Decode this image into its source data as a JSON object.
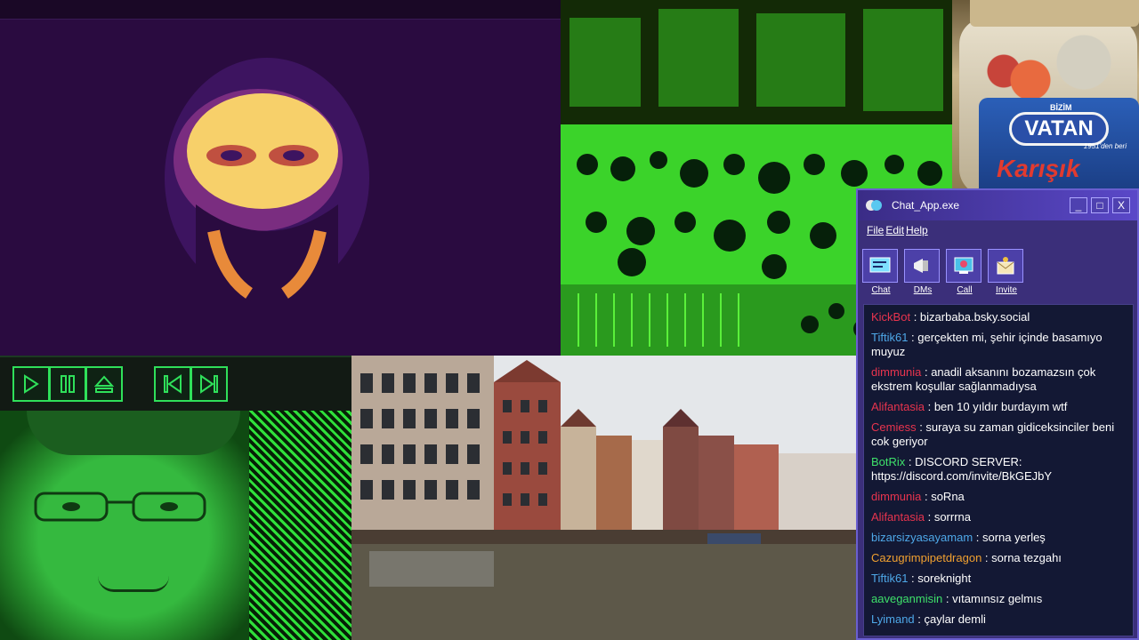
{
  "chat": {
    "title": "Chat_App.exe",
    "window_buttons": [
      "_",
      "□",
      "X"
    ],
    "menu": [
      "File",
      "Edit",
      "Help"
    ],
    "toolbar": [
      {
        "label": "Chat",
        "icon": "chat-icon"
      },
      {
        "label": "DMs",
        "icon": "megaphone-icon"
      },
      {
        "label": "Call",
        "icon": "call-icon"
      },
      {
        "label": "Invite",
        "icon": "invite-icon"
      }
    ],
    "messages": [
      {
        "user": "KickBot",
        "color": "#e8344e",
        "text": "bizarbaba.bsky.social"
      },
      {
        "user": "Tiftik61",
        "color": "#4ea8e8",
        "text": "gerçekten mi, şehir içinde basamıyo muyuz"
      },
      {
        "user": "dimmunia",
        "color": "#e8344e",
        "text": "anadil aksanını bozamazsın çok ekstrem koşullar sağlanmadıysa"
      },
      {
        "user": "Alifantasia",
        "color": "#e8344e",
        "text": "ben 10 yıldır burdayım wtf"
      },
      {
        "user": "Cemiess",
        "color": "#e8344e",
        "text": "suraya su zaman gidiceksinciler beni cok geriyor"
      },
      {
        "user": "BotRix",
        "color": "#3ee06a",
        "text": "DISCORD SERVER: https://discord.com/invite/BkGEJbY"
      },
      {
        "user": "dimmunia",
        "color": "#e8344e",
        "text": "soRna"
      },
      {
        "user": "Alifantasia",
        "color": "#e8344e",
        "text": "sorrrna"
      },
      {
        "user": "bizarsizyasayamam",
        "color": "#4ea8e8",
        "text": "sorna yerleş"
      },
      {
        "user": "Cazugrimpipetdragon",
        "color": "#f0a030",
        "text": "sorna tezgahı"
      },
      {
        "user": "Tiftik61",
        "color": "#4ea8e8",
        "text": "soreknight"
      },
      {
        "user": "aaveganmisin",
        "color": "#3ee06a",
        "text": "vıtamınsız gelmıs"
      },
      {
        "user": "Lyimand",
        "color": "#4ea8e8",
        "text": "çaylar demli"
      }
    ]
  },
  "jar": {
    "brand_top": "BİZİM",
    "brand": "VATAN",
    "brand_sub": "1951'den beri",
    "variety": "Karışık"
  },
  "controls": [
    {
      "name": "play-button",
      "icon": "play-icon"
    },
    {
      "name": "pause-button",
      "icon": "pause-icon"
    },
    {
      "name": "eject-button",
      "icon": "eject-icon"
    },
    {
      "name": "previous-button",
      "icon": "previous-icon"
    },
    {
      "name": "next-button",
      "icon": "next-icon"
    }
  ],
  "colors": {
    "accent_green": "#2fe05a",
    "chat_bg": "#3b2f7a",
    "log_bg": "#131834"
  }
}
